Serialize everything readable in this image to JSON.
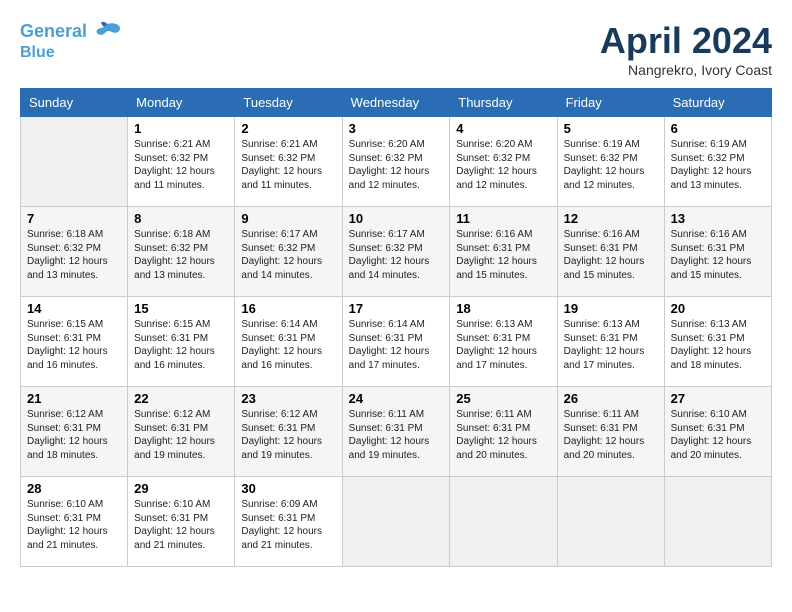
{
  "header": {
    "logo_line1": "General",
    "logo_line2": "Blue",
    "month_title": "April 2024",
    "location": "Nangrekro, Ivory Coast"
  },
  "days_of_week": [
    "Sunday",
    "Monday",
    "Tuesday",
    "Wednesday",
    "Thursday",
    "Friday",
    "Saturday"
  ],
  "weeks": [
    [
      {
        "day": "",
        "sunrise": "",
        "sunset": "",
        "daylight": ""
      },
      {
        "day": "1",
        "sunrise": "6:21 AM",
        "sunset": "6:32 PM",
        "daylight": "12 hours and 11 minutes."
      },
      {
        "day": "2",
        "sunrise": "6:21 AM",
        "sunset": "6:32 PM",
        "daylight": "12 hours and 11 minutes."
      },
      {
        "day": "3",
        "sunrise": "6:20 AM",
        "sunset": "6:32 PM",
        "daylight": "12 hours and 12 minutes."
      },
      {
        "day": "4",
        "sunrise": "6:20 AM",
        "sunset": "6:32 PM",
        "daylight": "12 hours and 12 minutes."
      },
      {
        "day": "5",
        "sunrise": "6:19 AM",
        "sunset": "6:32 PM",
        "daylight": "12 hours and 12 minutes."
      },
      {
        "day": "6",
        "sunrise": "6:19 AM",
        "sunset": "6:32 PM",
        "daylight": "12 hours and 13 minutes."
      }
    ],
    [
      {
        "day": "7",
        "sunrise": "6:18 AM",
        "sunset": "6:32 PM",
        "daylight": "12 hours and 13 minutes."
      },
      {
        "day": "8",
        "sunrise": "6:18 AM",
        "sunset": "6:32 PM",
        "daylight": "12 hours and 13 minutes."
      },
      {
        "day": "9",
        "sunrise": "6:17 AM",
        "sunset": "6:32 PM",
        "daylight": "12 hours and 14 minutes."
      },
      {
        "day": "10",
        "sunrise": "6:17 AM",
        "sunset": "6:32 PM",
        "daylight": "12 hours and 14 minutes."
      },
      {
        "day": "11",
        "sunrise": "6:16 AM",
        "sunset": "6:31 PM",
        "daylight": "12 hours and 15 minutes."
      },
      {
        "day": "12",
        "sunrise": "6:16 AM",
        "sunset": "6:31 PM",
        "daylight": "12 hours and 15 minutes."
      },
      {
        "day": "13",
        "sunrise": "6:16 AM",
        "sunset": "6:31 PM",
        "daylight": "12 hours and 15 minutes."
      }
    ],
    [
      {
        "day": "14",
        "sunrise": "6:15 AM",
        "sunset": "6:31 PM",
        "daylight": "12 hours and 16 minutes."
      },
      {
        "day": "15",
        "sunrise": "6:15 AM",
        "sunset": "6:31 PM",
        "daylight": "12 hours and 16 minutes."
      },
      {
        "day": "16",
        "sunrise": "6:14 AM",
        "sunset": "6:31 PM",
        "daylight": "12 hours and 16 minutes."
      },
      {
        "day": "17",
        "sunrise": "6:14 AM",
        "sunset": "6:31 PM",
        "daylight": "12 hours and 17 minutes."
      },
      {
        "day": "18",
        "sunrise": "6:13 AM",
        "sunset": "6:31 PM",
        "daylight": "12 hours and 17 minutes."
      },
      {
        "day": "19",
        "sunrise": "6:13 AM",
        "sunset": "6:31 PM",
        "daylight": "12 hours and 17 minutes."
      },
      {
        "day": "20",
        "sunrise": "6:13 AM",
        "sunset": "6:31 PM",
        "daylight": "12 hours and 18 minutes."
      }
    ],
    [
      {
        "day": "21",
        "sunrise": "6:12 AM",
        "sunset": "6:31 PM",
        "daylight": "12 hours and 18 minutes."
      },
      {
        "day": "22",
        "sunrise": "6:12 AM",
        "sunset": "6:31 PM",
        "daylight": "12 hours and 19 minutes."
      },
      {
        "day": "23",
        "sunrise": "6:12 AM",
        "sunset": "6:31 PM",
        "daylight": "12 hours and 19 minutes."
      },
      {
        "day": "24",
        "sunrise": "6:11 AM",
        "sunset": "6:31 PM",
        "daylight": "12 hours and 19 minutes."
      },
      {
        "day": "25",
        "sunrise": "6:11 AM",
        "sunset": "6:31 PM",
        "daylight": "12 hours and 20 minutes."
      },
      {
        "day": "26",
        "sunrise": "6:11 AM",
        "sunset": "6:31 PM",
        "daylight": "12 hours and 20 minutes."
      },
      {
        "day": "27",
        "sunrise": "6:10 AM",
        "sunset": "6:31 PM",
        "daylight": "12 hours and 20 minutes."
      }
    ],
    [
      {
        "day": "28",
        "sunrise": "6:10 AM",
        "sunset": "6:31 PM",
        "daylight": "12 hours and 21 minutes."
      },
      {
        "day": "29",
        "sunrise": "6:10 AM",
        "sunset": "6:31 PM",
        "daylight": "12 hours and 21 minutes."
      },
      {
        "day": "30",
        "sunrise": "6:09 AM",
        "sunset": "6:31 PM",
        "daylight": "12 hours and 21 minutes."
      },
      {
        "day": "",
        "sunrise": "",
        "sunset": "",
        "daylight": ""
      },
      {
        "day": "",
        "sunrise": "",
        "sunset": "",
        "daylight": ""
      },
      {
        "day": "",
        "sunrise": "",
        "sunset": "",
        "daylight": ""
      },
      {
        "day": "",
        "sunrise": "",
        "sunset": "",
        "daylight": ""
      }
    ]
  ],
  "labels": {
    "sunrise": "Sunrise:",
    "sunset": "Sunset:",
    "daylight": "Daylight:"
  }
}
